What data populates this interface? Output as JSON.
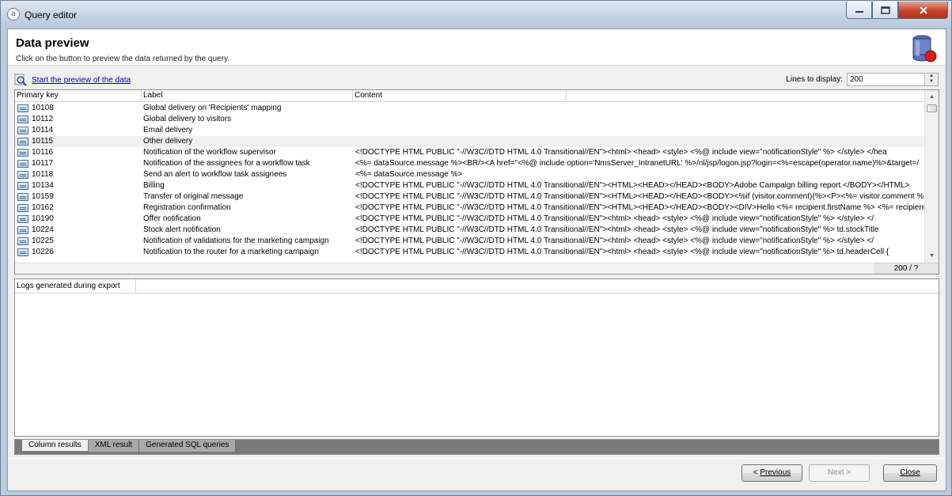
{
  "window": {
    "title": "Query editor"
  },
  "header": {
    "title": "Data preview",
    "subtitle": "Click on the button to preview the data returned by the query."
  },
  "toolbar": {
    "preview_link": "Start the preview of the data",
    "lines_label": "Lines to display:",
    "lines_value": "200"
  },
  "grid": {
    "columns": [
      "Primary key",
      "Label",
      "Content"
    ],
    "rows": [
      {
        "key": "10108",
        "label": "Global delivery on 'Recipients' mapping",
        "content": ""
      },
      {
        "key": "10112",
        "label": "Global delivery to visitors",
        "content": ""
      },
      {
        "key": "10114",
        "label": "Email delivery",
        "content": ""
      },
      {
        "key": "10115",
        "label": "Other delivery",
        "content": ""
      },
      {
        "key": "10116",
        "label": "Notification of the workflow supervisor",
        "content": "<!DOCTYPE HTML PUBLIC \"-//W3C//DTD HTML 4.0 Transitional//EN\"><html> <head> <style> <%@ include view=\"notificationStyle\" %> </style> </hea"
      },
      {
        "key": "10117",
        "label": "Notification of the assignees for a workflow task",
        "content": "<%= dataSource.message %><BR/><A href=\"<%@ include option='NmsServer_IntranetURL' %>/nl/jsp/logon.jsp?login=<%=escape(operator.name)%>&target=/"
      },
      {
        "key": "10118",
        "label": "Send an alert to workflow task assignees",
        "content": "<%= dataSource.message %>"
      },
      {
        "key": "10134",
        "label": "Billing",
        "content": "<!DOCTYPE HTML PUBLIC \"-//W3C//DTD HTML 4.0 Transitional//EN\"><HTML><HEAD></HEAD><BODY>Adobe Campaign billing report.</BODY></HTML>"
      },
      {
        "key": "10159",
        "label": "Transfer of original message",
        "content": "<!DOCTYPE HTML PUBLIC \"-//W3C//DTD HTML 4.0 Transitional//EN\"><HTML><HEAD></HEAD><BODY><%if (visitor.comment){%><P><%= visitor.comment %"
      },
      {
        "key": "10162",
        "label": "Registration confirmation",
        "content": "<!DOCTYPE HTML PUBLIC \"-//W3C//DTD HTML 4.0 Transitional//EN\"><HTML><HEAD></HEAD><BODY><DIV>Hello <%= recipient.firstName %> <%= recipient"
      },
      {
        "key": "10190",
        "label": "Offer notification",
        "content": "<!DOCTYPE HTML PUBLIC \"-//W3C//DTD HTML 4.0 Transitional//EN\"><html> <head> <style> <%@ include view=\"notificationStyle\" %> </style> </"
      },
      {
        "key": "10224",
        "label": "Stock alert notification",
        "content": "<!DOCTYPE HTML PUBLIC \"-//W3C//DTD HTML 4.0 Transitional//EN\"><html> <head> <style> <%@ include view=\"notificationStyle\" %> td.stockTitle"
      },
      {
        "key": "10225",
        "label": "Notification of validations for the marketing campaign",
        "content": "<!DOCTYPE HTML PUBLIC \"-//W3C//DTD HTML 4.0 Transitional//EN\"><html> <head> <style> <%@ include view=\"notificationStyle\" %> </style> </"
      },
      {
        "key": "10226",
        "label": "Notification to the router for a marketing campaign",
        "content": "<!DOCTYPE HTML PUBLIC \"-//W3C//DTD HTML 4.0 Transitional//EN\"><html> <head> <style> <%@ include view=\"notificationStyle\" %> td.headerCell {"
      }
    ],
    "count_status": "200 / ?"
  },
  "logs": {
    "header": "Logs generated during export"
  },
  "tabs": [
    "Column results",
    "XML result",
    "Generated SQL queries"
  ],
  "buttons": {
    "previous": "Previous",
    "next": "Next >",
    "close": "Close"
  },
  "colors": {
    "link": "#0000cc",
    "close_button": "#c7432a",
    "selected_row": "#f0f0f0"
  },
  "icons": {
    "app": "app-icon",
    "db": "database-icon",
    "preview": "magnifier-icon",
    "row": "record-icon"
  }
}
